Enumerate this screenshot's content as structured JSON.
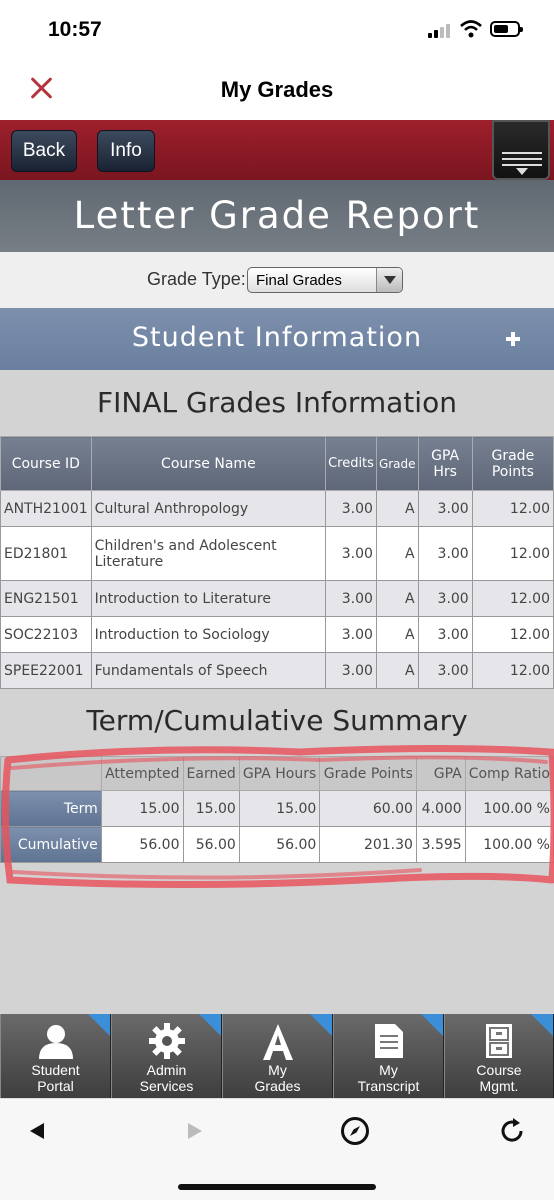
{
  "status": {
    "time": "10:57"
  },
  "nav": {
    "title": "My Grades"
  },
  "toolbar": {
    "back": "Back",
    "info": "Info"
  },
  "banner": {
    "title": "Letter Grade Report"
  },
  "grade_type": {
    "label": "Grade Type:",
    "selected": "Final Grades"
  },
  "student_info": {
    "title": "Student Information"
  },
  "grades": {
    "title": "FINAL Grades Information",
    "headers": [
      "Course ID",
      "Course Name",
      "Credits",
      "Grade",
      "GPA Hrs",
      "Grade Points"
    ],
    "rows": [
      [
        "ANTH21001",
        "Cultural Anthropology",
        "3.00",
        "A",
        "3.00",
        "12.00"
      ],
      [
        "ED21801",
        "Children's and Adolescent Literature",
        "3.00",
        "A",
        "3.00",
        "12.00"
      ],
      [
        "ENG21501",
        "Introduction to Literature",
        "3.00",
        "A",
        "3.00",
        "12.00"
      ],
      [
        "SOC22103",
        "Introduction to Sociology",
        "3.00",
        "A",
        "3.00",
        "12.00"
      ],
      [
        "SPEE22001",
        "Fundamentals of Speech",
        "3.00",
        "A",
        "3.00",
        "12.00"
      ]
    ]
  },
  "summary": {
    "title": "Term/Cumulative Summary",
    "headers": [
      "",
      "Attempted",
      "Earned",
      "GPA Hours",
      "Grade Points",
      "GPA",
      "Comp Ratio"
    ],
    "rows": [
      [
        "Term",
        "15.00",
        "15.00",
        "15.00",
        "60.00",
        "4.000",
        "100.00 %"
      ],
      [
        "Cumulative",
        "56.00",
        "56.00",
        "56.00",
        "201.30",
        "3.595",
        "100.00 %"
      ]
    ]
  },
  "tabs": [
    {
      "label1": "Student",
      "label2": "Portal",
      "icon": "person-icon"
    },
    {
      "label1": "Admin",
      "label2": "Services",
      "icon": "gear-icon"
    },
    {
      "label1": "My",
      "label2": "Grades",
      "icon": "letter-a-icon"
    },
    {
      "label1": "My",
      "label2": "Transcript",
      "icon": "document-icon"
    },
    {
      "label1": "Course",
      "label2": "Mgmt.",
      "icon": "cabinet-icon"
    }
  ],
  "colors": {
    "toolbar_red": "#8a1a26",
    "section_blue": "#7d90ad",
    "tab_badge_blue": "#3a8fd8",
    "highlight_red": "#e8545e"
  }
}
